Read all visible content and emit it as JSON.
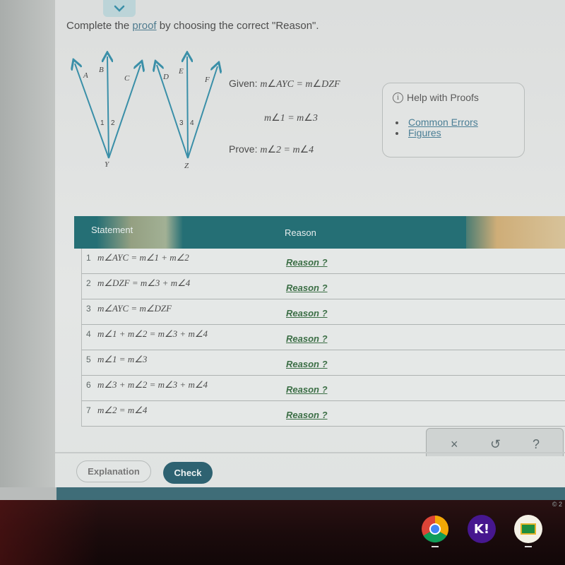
{
  "instruction": {
    "prefix": "Complete the ",
    "link": "proof",
    "suffix": " by choosing the correct \"Reason\"."
  },
  "figure": {
    "left_angle": {
      "rays": [
        "A",
        "B",
        "C"
      ],
      "vertex": "Y",
      "angle_labels": [
        "1",
        "2"
      ]
    },
    "right_angle": {
      "rays": [
        "D",
        "E",
        "F"
      ],
      "vertex": "Z",
      "angle_labels": [
        "3",
        "4"
      ]
    },
    "stroke_color": "#3a8fa8"
  },
  "given": {
    "label": "Given:",
    "line1": {
      "m": "m",
      "angle": "∠",
      "lhs": "AYC",
      "eq": " = ",
      "rhs": "DZF"
    },
    "line2": {
      "lhs": "1",
      "rhs": "3"
    }
  },
  "prove": {
    "label": "Prove:",
    "lhs": "2",
    "rhs": "4"
  },
  "help": {
    "title": "Help with Proofs",
    "icon": "info-icon",
    "links": [
      "Common Errors",
      "Figures"
    ]
  },
  "table": {
    "headers": {
      "statement": "Statement",
      "reason": "Reason"
    },
    "header_color": "#256f75",
    "rows": [
      {
        "num": "1",
        "statement": "m∠AYC = m∠1 + m∠2",
        "reason": "Reason ?"
      },
      {
        "num": "2",
        "statement": "m∠DZF = m∠3 + m∠4",
        "reason": "Reason ?"
      },
      {
        "num": "3",
        "statement": "m∠AYC = m∠DZF",
        "reason": "Reason ?"
      },
      {
        "num": "4",
        "statement": "m∠1 + m∠2 = m∠3 + m∠4",
        "reason": "Reason ?"
      },
      {
        "num": "5",
        "statement": "m∠1 = m∠3",
        "reason": "Reason ?"
      },
      {
        "num": "6",
        "statement": "m∠3 + m∠2 = m∠3 + m∠4",
        "reason": "Reason ?"
      },
      {
        "num": "7",
        "statement": "m∠2 = m∠4",
        "reason": "Reason ?"
      }
    ]
  },
  "toolbox": {
    "clear": "×",
    "undo": "↺",
    "help": "?"
  },
  "buttons": {
    "explanation": "Explanation",
    "check": "Check"
  },
  "copyright": "© 2",
  "shelf": {
    "apps": [
      {
        "name": "Chrome"
      },
      {
        "name": "Kahoot",
        "label": "K!"
      },
      {
        "name": "Google Classroom"
      }
    ]
  }
}
